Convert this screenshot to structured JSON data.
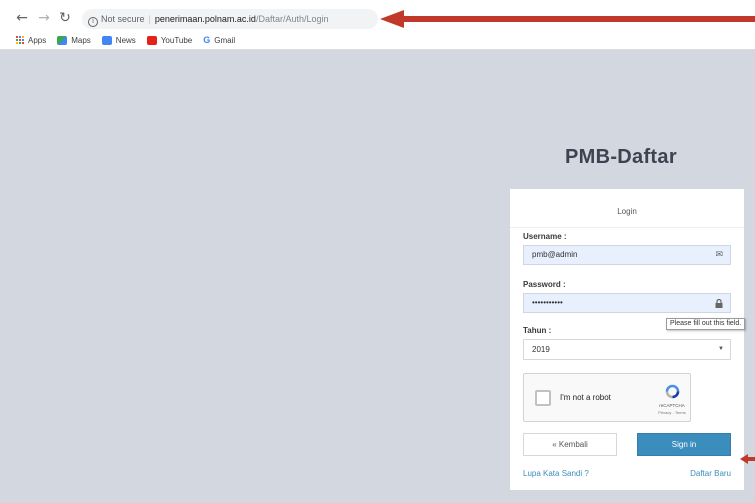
{
  "browser": {
    "security_label": "Not secure",
    "url_host": "penerimaan.polnam.ac.id",
    "url_path": "/Daftar/Auth/Login",
    "bookmarks": [
      {
        "label": "Apps",
        "icon": "apps-grid-icon"
      },
      {
        "label": "Maps",
        "icon": "maps-icon"
      },
      {
        "label": "News",
        "icon": "news-icon"
      },
      {
        "label": "YouTube",
        "icon": "youtube-icon"
      },
      {
        "label": "Gmail",
        "icon": "google-icon"
      }
    ]
  },
  "page": {
    "title": "PMB-Daftar"
  },
  "login": {
    "header": "Login",
    "username_label": "Username :",
    "username_value": "pmb@admin",
    "password_label": "Password :",
    "password_value": "•••••••••••",
    "year_label": "Tahun :",
    "year_value": "2019",
    "tooltip": "Please fill out this field.",
    "captcha_text": "I'm not a robot",
    "captcha_brand": "reCAPTCHA",
    "captcha_terms": "Privacy - Terms",
    "back_button": "« Kembali",
    "signin_button": "Sign in",
    "forgot_link": "Lupa Kata Sandi ?",
    "register_link": "Daftar Baru"
  },
  "colors": {
    "annotation_arrow": "#c0392b",
    "signin_button": "#3b8dbd",
    "link": "#3c8dbc",
    "page_background": "#d2d7e0"
  }
}
